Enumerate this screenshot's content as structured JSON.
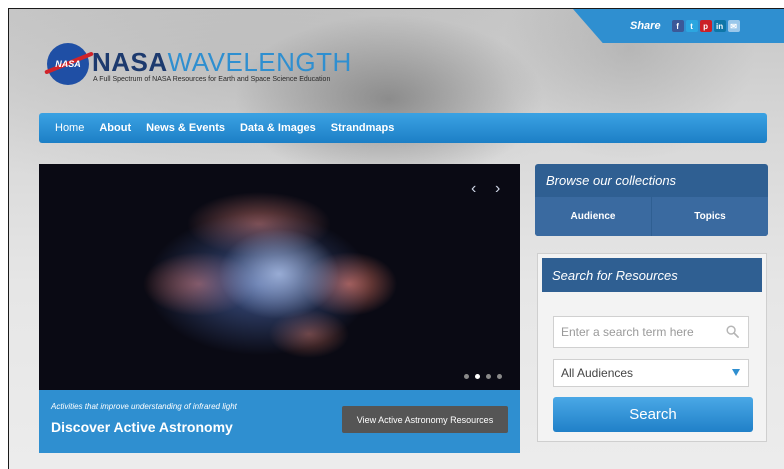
{
  "header": {
    "brand_bold": "NASA",
    "brand_light": "WAVELENGTH",
    "tagline": "A Full Spectrum of NASA Resources for Earth and Space Science Education",
    "logo_text": "NASA"
  },
  "share": {
    "label": "Share",
    "icons": [
      {
        "name": "facebook-icon",
        "glyph": "f",
        "color": "#3b5998"
      },
      {
        "name": "twitter-icon",
        "glyph": "t",
        "color": "#2ca6e0"
      },
      {
        "name": "pinterest-icon",
        "glyph": "p",
        "color": "#cb2027"
      },
      {
        "name": "linkedin-icon",
        "glyph": "in",
        "color": "#0e76a8"
      },
      {
        "name": "email-icon",
        "glyph": "✉",
        "color": "#9ac7ea"
      }
    ]
  },
  "nav": {
    "items": [
      "Home",
      "About",
      "News & Events",
      "Data & Images",
      "Strandmaps"
    ]
  },
  "hero": {
    "prev": "‹",
    "next": "›",
    "slide_count": 4,
    "active_slide": 2,
    "caption_sub": "Activities that improve understanding of infrared light",
    "caption_title": "Discover Active Astronomy",
    "button": "View Active Astronomy Resources"
  },
  "browse": {
    "title": "Browse our collections",
    "tabs": [
      "Audience",
      "Topics"
    ]
  },
  "search": {
    "title": "Search for Resources",
    "placeholder": "Enter a search term here",
    "audience": "All Audiences",
    "button": "Search"
  },
  "colors": {
    "accent": "#2f8fd0",
    "panel": "#2f5f92"
  }
}
